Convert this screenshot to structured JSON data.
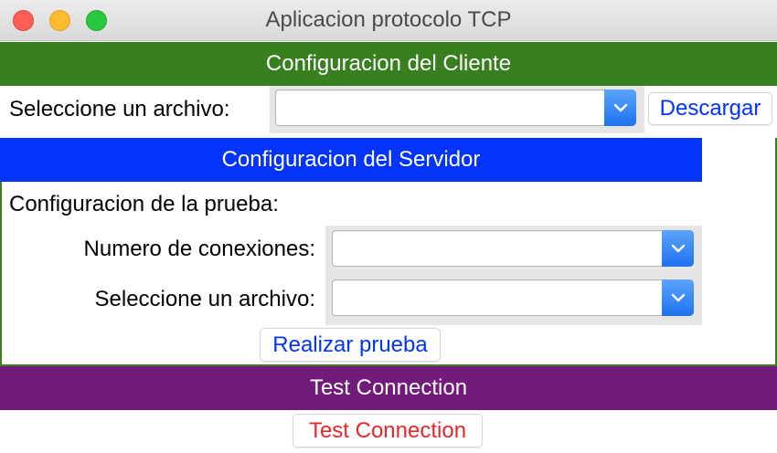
{
  "window": {
    "title": "Aplicacion protocolo TCP"
  },
  "client": {
    "header": "Configuracion del Cliente",
    "file_label": "Seleccione un archivo:",
    "file_value": "",
    "download_button": "Descargar"
  },
  "server": {
    "header": "Configuracion del Servidor",
    "test_config_label": "Configuracion de la prueba:",
    "connections_label": "Numero de conexiones:",
    "connections_value": "",
    "file_label": "Seleccione un archivo:",
    "file_value": "",
    "run_test_button": "Realizar prueba"
  },
  "test": {
    "header": "Test Connection",
    "button": "Test Connection"
  },
  "colors": {
    "client_header": "#38801f",
    "server_header": "#0433fa",
    "test_header": "#731b7b",
    "button_text_blue": "#0433fa",
    "button_text_red": "#e8262a"
  },
  "icons": [
    "close-window-icon",
    "minimize-window-icon",
    "zoom-window-icon",
    "chevron-down-icon"
  ]
}
